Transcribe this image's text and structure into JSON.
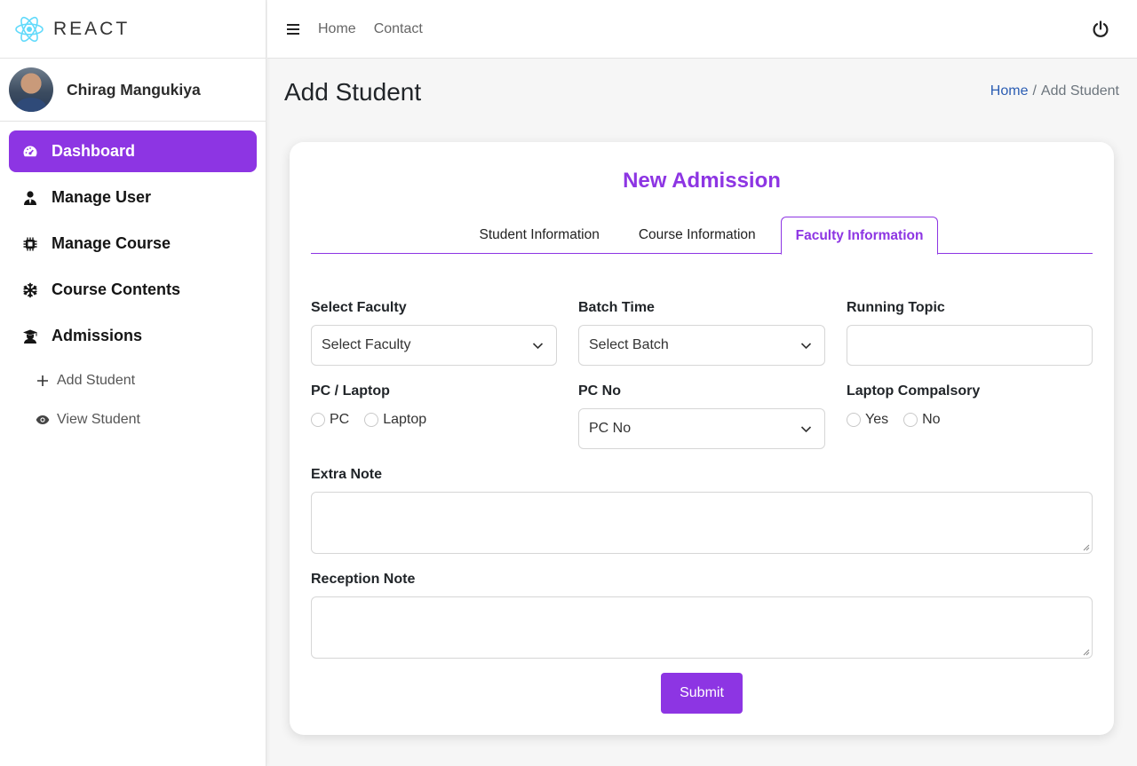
{
  "brand": {
    "name": "REACT"
  },
  "user": {
    "name": "Chirag Mangukiya"
  },
  "sidebar": {
    "items": [
      {
        "label": "Dashboard",
        "icon": "dashboard-gauge-icon",
        "active": true
      },
      {
        "label": "Manage User",
        "icon": "user-tie-icon"
      },
      {
        "label": "Manage Course",
        "icon": "microchip-icon"
      },
      {
        "label": "Course Contents",
        "icon": "snowflake-icon"
      },
      {
        "label": "Admissions",
        "icon": "graduate-icon"
      }
    ],
    "sub_items": [
      {
        "label": "Add Student",
        "icon": "plus-icon"
      },
      {
        "label": "View Student",
        "icon": "eye-icon"
      }
    ]
  },
  "header": {
    "links": [
      "Home",
      "Contact"
    ],
    "menu_icon": "hamburger-icon",
    "power_icon": "power-icon"
  },
  "page": {
    "title": "Add Student",
    "breadcrumb": {
      "home": "Home",
      "separator": "/",
      "current": "Add Student"
    }
  },
  "form": {
    "title": "New Admission",
    "tabs": [
      "Student Information",
      "Course Information",
      "Faculty Information"
    ],
    "active_tab": "Faculty Information",
    "select_faculty": {
      "label": "Select Faculty",
      "value": "Select Faculty"
    },
    "batch_time": {
      "label": "Batch Time",
      "value": "Select Batch"
    },
    "running_topic": {
      "label": "Running Topic",
      "value": ""
    },
    "pc_laptop": {
      "label": "PC / Laptop",
      "options": [
        "PC",
        "Laptop"
      ]
    },
    "pc_no": {
      "label": "PC No",
      "value": "PC No"
    },
    "laptop_compulsory": {
      "label": "Laptop Compalsory",
      "options": [
        "Yes",
        "No"
      ]
    },
    "extra_note": {
      "label": "Extra Note",
      "value": ""
    },
    "reception_note": {
      "label": "Reception Note",
      "value": ""
    },
    "submit_label": "Submit"
  },
  "colors": {
    "accent": "#8d35e3",
    "link": "#2b5db3",
    "react_logo": "#61dafb"
  }
}
